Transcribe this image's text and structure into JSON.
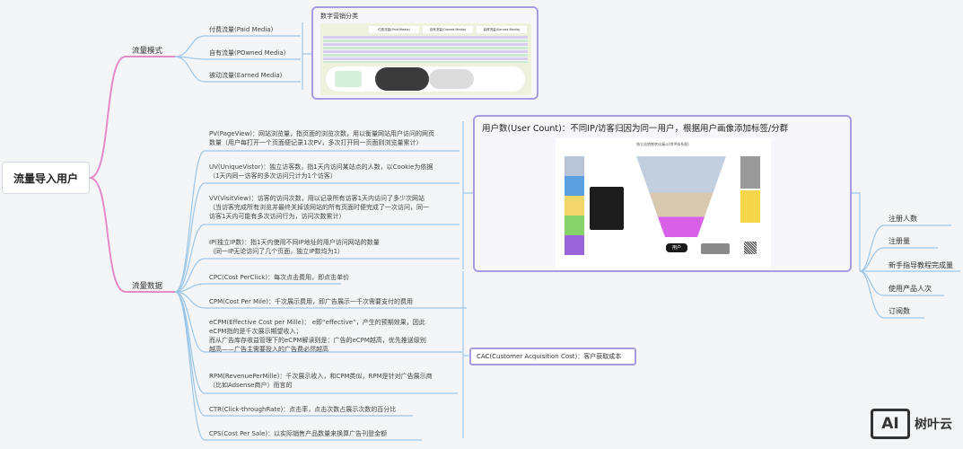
{
  "root": "流量导入用户",
  "traffic_modes": {
    "label": "流量模式",
    "items": [
      "付费流量(Paid Media)",
      "自有流量(POwned Media)",
      "被动流量(Earned Media)"
    ],
    "image": {
      "title": "数字营销分类",
      "columns": [
        "付费流量(Paid Media)",
        "自有流量(Owned Media)",
        "赢得流量(Earned Media)"
      ]
    }
  },
  "traffic_data": {
    "label": "流量数据",
    "metrics_group1": [
      {
        "line1": "PV(PageView)：网站浏览量，指页面的浏览次数，用以衡量网站用户访问的网页",
        "line2": "数量（用户每打开一个页面便记录1次PV，多次打开同一页面则浏览量累计）"
      },
      {
        "line1": "UV(UniqueVistor)：独立访客数，指1天内访问某站点的人数，以Cookie为依据",
        "line2": "（1天内同一访客的多次访问只计为1个访客）"
      },
      {
        "line1": "VV(VisitView)：访客的访问次数，用以记录所有访客1天内访问了多少次网站",
        "line2": "（当访客完成所有浏览并最终关掉该网站的所有页面时便完成了一次访问，同一",
        "line3": "访客1天内可能有多次访问行为，访问次数累计）"
      },
      {
        "line1": "IP(独立IP数)：指1天内使用不同IP地址的用户访问网站的数量",
        "line2": "（同一IP无论访问了几个页面，独立IP数均为1）"
      }
    ],
    "user_count": {
      "title": "用户数(User Count)：不同IP/访客归因为同一用户，根据用户画像添加标签/分群",
      "image_title": "独立站销售转化漏斗(附IP体系图)",
      "image_button": "用户"
    },
    "user_metrics": [
      "注册人数",
      "注册量",
      "新手指导教程完成量",
      "使用产品人次",
      "订阅数"
    ],
    "metrics_group2": [
      {
        "line1": "CPC(Cost PerClick)：每次点击费用，即点击单价"
      },
      {
        "line1": "CPM(Cost Per Mile)：千次展示费用，即广告展示一千次需要支付的费用"
      },
      {
        "line1": "eCPM(Effective Cost per Mille)： e即“effective”，产生的预期效果，因此",
        "line2": "eCPM指的是千次展示期望收入；",
        "line3": "而从广告库存收益管理下的eCPM解读则是：广告的eCPM越高，优先推送级别",
        "line4": "越高——广告主需要投入的广告费必然越高"
      },
      {
        "line1": "RPM(RevenuePerMille)：千次展示收入，和CPM类似，RPM是针对广告展示商",
        "line2": "（比如Adsense商户）而言的"
      },
      {
        "line1": "CTR(Click-throughRate)：点击率，点击次数占展示次数的百分比"
      },
      {
        "line1": "CPS(Cost Per Sale)：以实际销售产品数量来换算广告刊登金额"
      }
    ],
    "cac": "CAC(Customer Acquisition Cost)：客户获取成本"
  },
  "watermark": {
    "logo": "AI",
    "text": "树叶云"
  }
}
